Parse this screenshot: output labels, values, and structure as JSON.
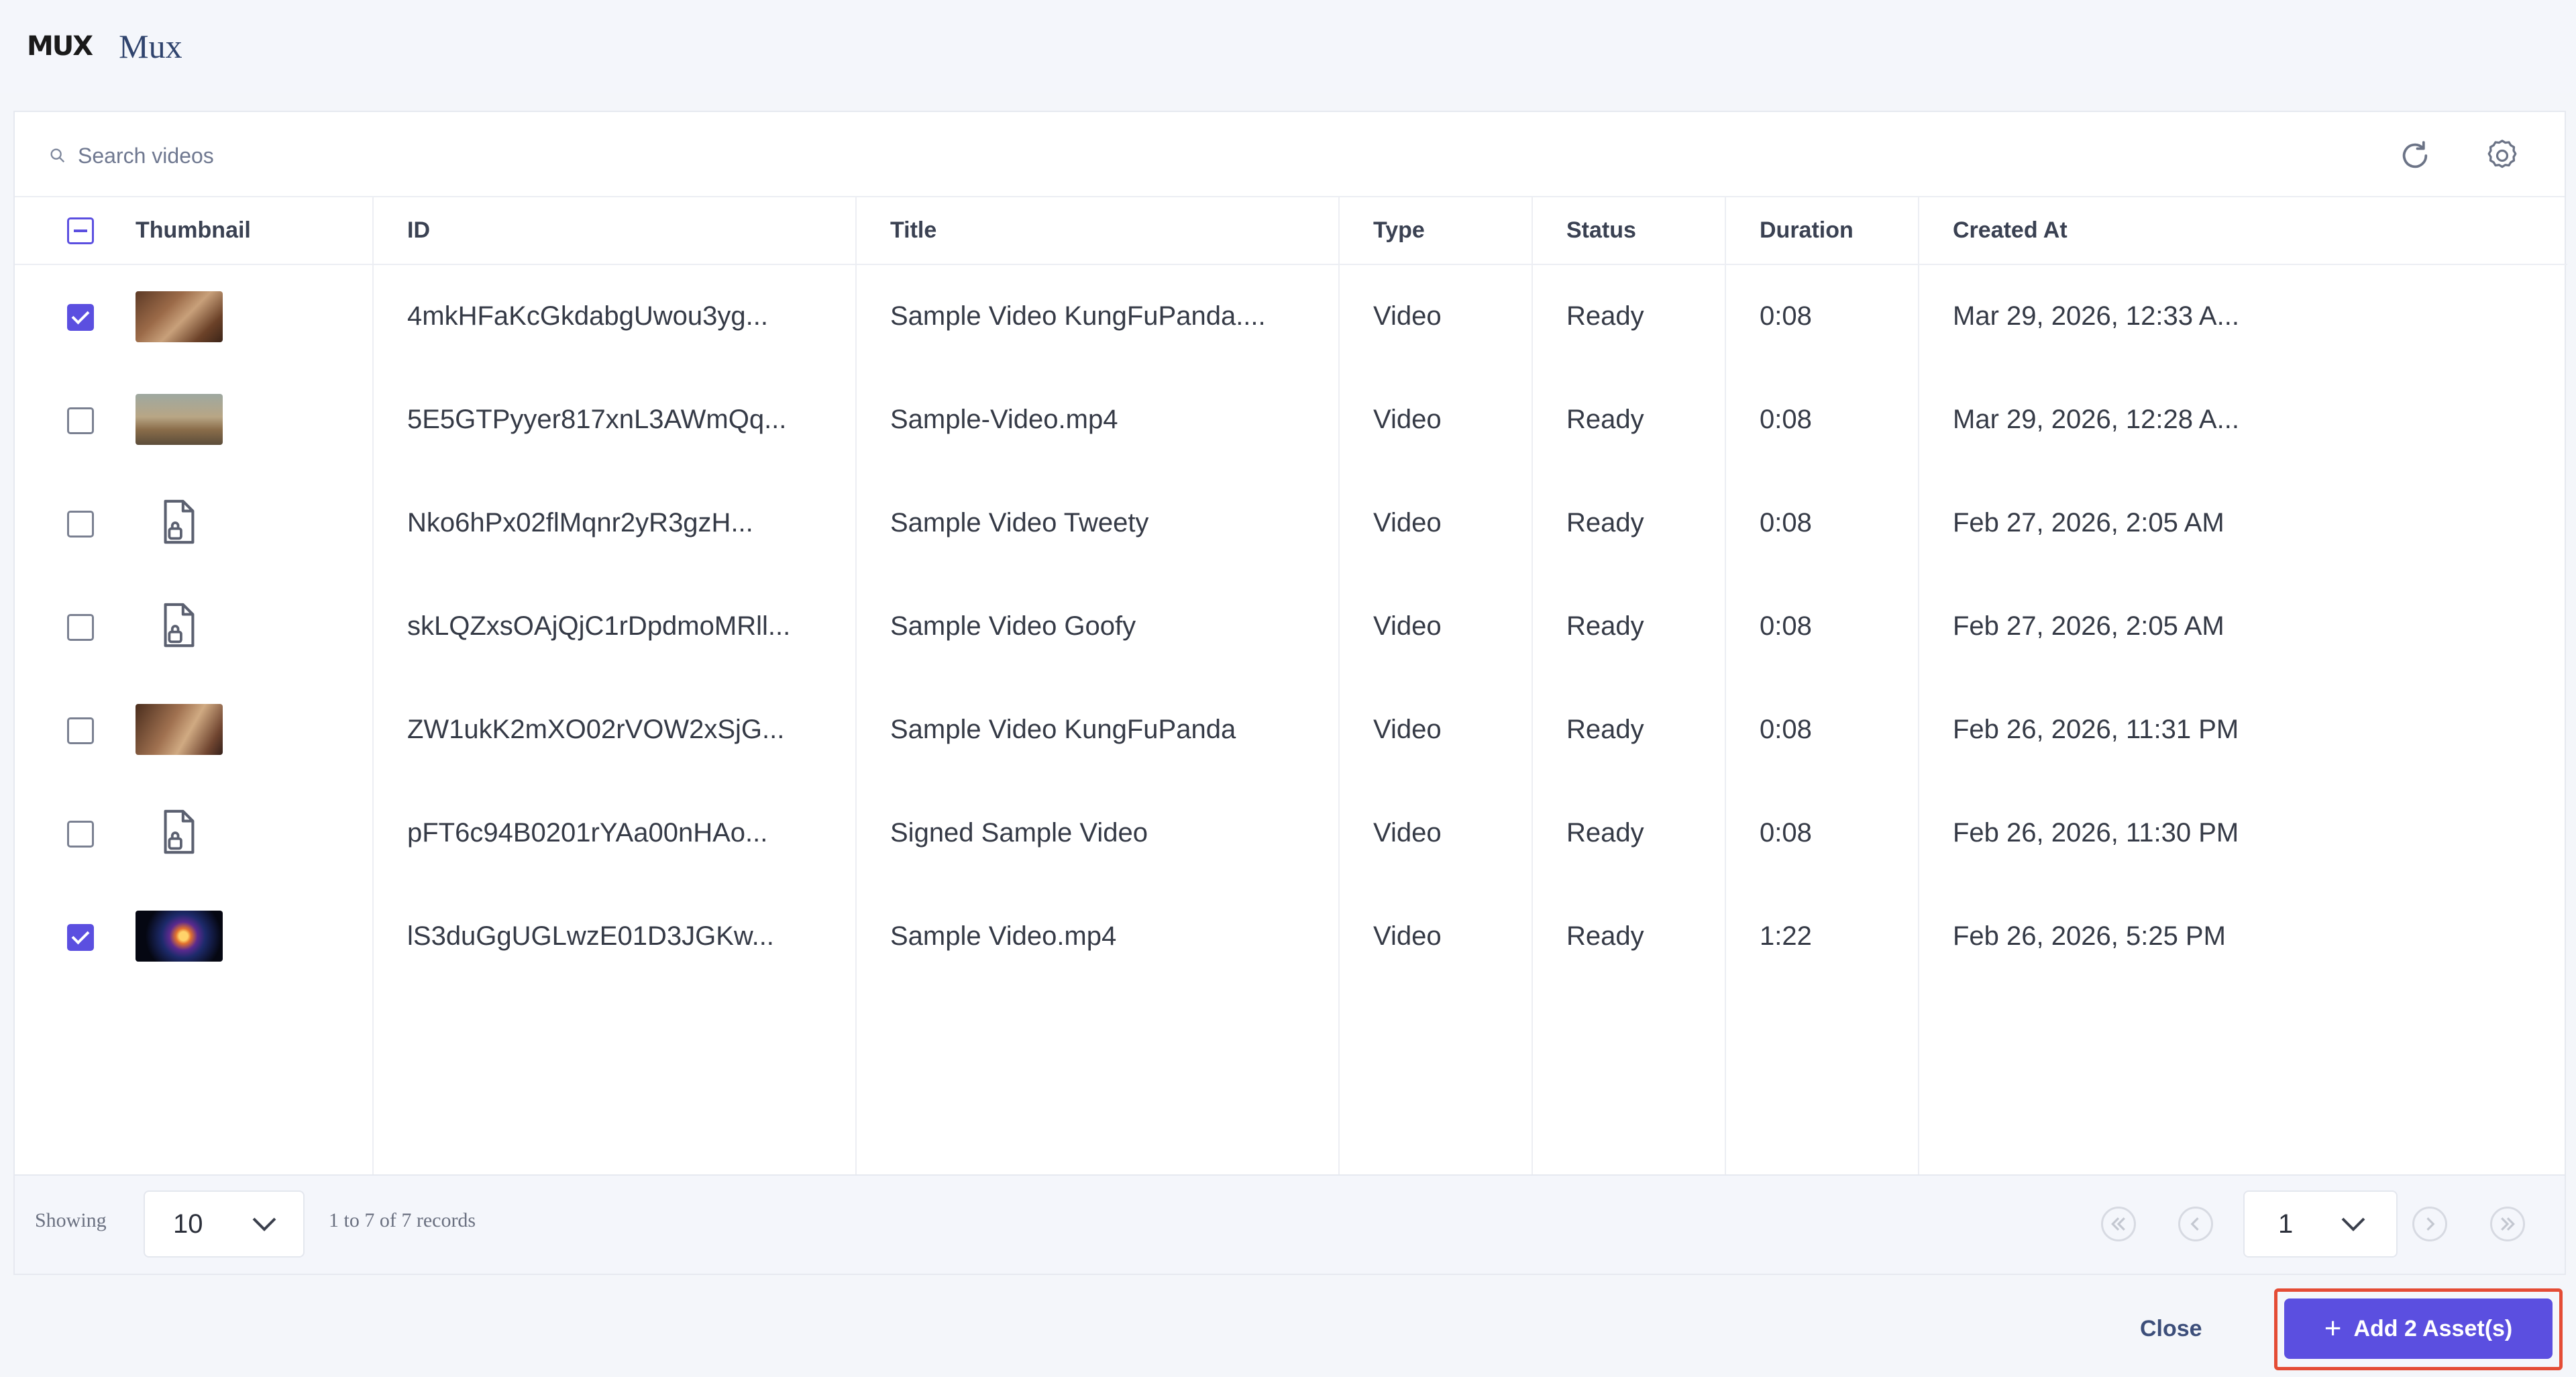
{
  "header": {
    "logo_text": "MUX",
    "title": "Mux"
  },
  "search": {
    "placeholder": "Search videos"
  },
  "table": {
    "columns": [
      "Thumbnail",
      "ID",
      "Title",
      "Type",
      "Status",
      "Duration",
      "Created At"
    ],
    "rows": [
      {
        "checked": true,
        "thumb": "kungfupanda-frame",
        "id": "4mkHFaKcGkdabgUwou3yg...",
        "title": "Sample Video KungFuPanda....",
        "type": "Video",
        "status": "Ready",
        "duration": "0:08",
        "created": "Mar 29, 2026, 12:33 A..."
      },
      {
        "checked": false,
        "thumb": "sample-video-frame",
        "id": "5E5GTPyyer817xnL3AWmQq...",
        "title": "Sample-Video.mp4",
        "type": "Video",
        "status": "Ready",
        "duration": "0:08",
        "created": "Mar 29, 2026, 12:28 A..."
      },
      {
        "checked": false,
        "thumb": "file-lock-icon",
        "id": "Nko6hPx02flMqnr2yR3gzH...",
        "title": "Sample Video Tweety",
        "type": "Video",
        "status": "Ready",
        "duration": "0:08",
        "created": "Feb 27, 2026, 2:05 AM"
      },
      {
        "checked": false,
        "thumb": "file-lock-icon",
        "id": "skLQZxsOAjQjC1rDpdmoMRll...",
        "title": "Sample Video Goofy",
        "type": "Video",
        "status": "Ready",
        "duration": "0:08",
        "created": "Feb 27, 2026, 2:05 AM"
      },
      {
        "checked": false,
        "thumb": "kungfupanda-frame",
        "id": "ZW1ukK2mXO02rVOW2xSjG...",
        "title": "Sample Video KungFuPanda",
        "type": "Video",
        "status": "Ready",
        "duration": "0:08",
        "created": "Feb 26, 2026, 11:31 PM"
      },
      {
        "checked": false,
        "thumb": "file-lock-icon",
        "id": "pFT6c94B0201rYAa00nHAo...",
        "title": "Signed Sample Video",
        "type": "Video",
        "status": "Ready",
        "duration": "0:08",
        "created": "Feb 26, 2026, 11:30 PM"
      },
      {
        "checked": true,
        "thumb": "galaxy-frame",
        "id": "lS3duGgUGLwzE01D3JGKw...",
        "title": "Sample Video.mp4",
        "type": "Video",
        "status": "Ready",
        "duration": "1:22",
        "created": "Feb 26, 2026, 5:25 PM"
      }
    ]
  },
  "footer": {
    "showing_label": "Showing",
    "page_size": "10",
    "records_text": "1 to 7 of 7 records",
    "current_page": "1"
  },
  "actions": {
    "close_label": "Close",
    "add_label": "Add 2 Asset(s)"
  },
  "colors": {
    "accent": "#5b4fe0",
    "highlight_outline": "#e44c35",
    "close_text": "#3c4e7a"
  },
  "icons": [
    "search-icon",
    "refresh-icon",
    "settings-icon",
    "file-lock-icon",
    "chevron-down-icon",
    "first-page-icon",
    "prev-page-icon",
    "next-page-icon",
    "last-page-icon",
    "plus-icon"
  ]
}
